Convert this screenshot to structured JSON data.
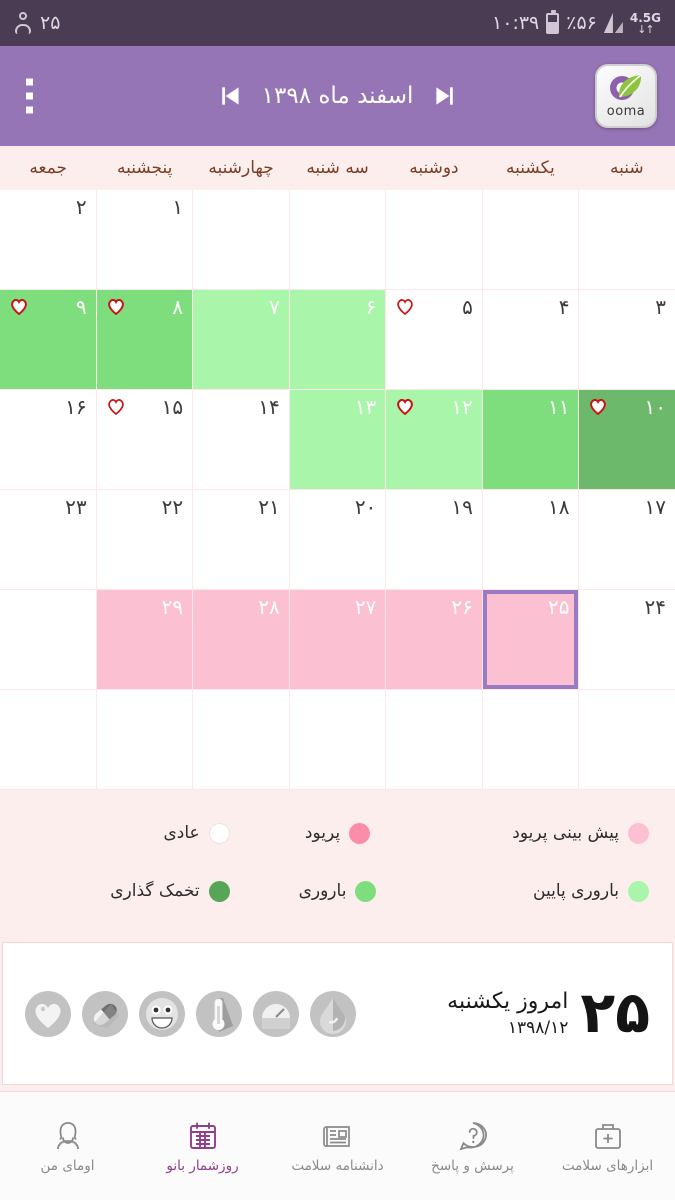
{
  "statusbar": {
    "time": "۱۰:۳۹",
    "battery_percent": "٪۵۶",
    "network": "4.5G",
    "network_arrows": "↓↑",
    "right_count": "۲۵",
    "icons": [
      "battery-icon",
      "signal-icon",
      "network-icon",
      "person-icon"
    ]
  },
  "toolbar": {
    "app_name": "ooma",
    "month_title": "اسفند ماه ۱۳۹۸",
    "prev_icon": "skip-previous-icon",
    "next_icon": "skip-next-icon",
    "overflow_icon": "overflow-menu-icon",
    "background": "#9575b5"
  },
  "weekdays": [
    "شنبه",
    "یکشنبه",
    "دوشنبه",
    "سه شنبه",
    "چهارشنبه",
    "پنجشنبه",
    "جمعه"
  ],
  "calendar": {
    "cells": [
      {
        "num": "",
        "status": "empty",
        "heart": "none",
        "today": false
      },
      {
        "num": "",
        "status": "empty",
        "heart": "none",
        "today": false
      },
      {
        "num": "",
        "status": "empty",
        "heart": "none",
        "today": false
      },
      {
        "num": "",
        "status": "empty",
        "heart": "none",
        "today": false
      },
      {
        "num": "",
        "status": "empty",
        "heart": "none",
        "today": false
      },
      {
        "num": "۱",
        "status": "normal",
        "heart": "none",
        "today": false
      },
      {
        "num": "۲",
        "status": "normal",
        "heart": "none",
        "today": false
      },
      {
        "num": "۳",
        "status": "normal",
        "heart": "none",
        "today": false
      },
      {
        "num": "۴",
        "status": "normal",
        "heart": "none",
        "today": false
      },
      {
        "num": "۵",
        "status": "normal",
        "heart": "outline",
        "today": false
      },
      {
        "num": "۶",
        "status": "fertile-low",
        "heart": "none",
        "today": false
      },
      {
        "num": "۷",
        "status": "fertile-low",
        "heart": "none",
        "today": false
      },
      {
        "num": "۸",
        "status": "fertile",
        "heart": "filled",
        "today": false
      },
      {
        "num": "۹",
        "status": "fertile",
        "heart": "filled",
        "today": false
      },
      {
        "num": "۱۰",
        "status": "ovulation",
        "heart": "filled",
        "today": false
      },
      {
        "num": "۱۱",
        "status": "fertile",
        "heart": "none",
        "today": false
      },
      {
        "num": "۱۲",
        "status": "fertile-low",
        "heart": "filled",
        "today": false
      },
      {
        "num": "۱۳",
        "status": "fertile-low",
        "heart": "none",
        "today": false
      },
      {
        "num": "۱۴",
        "status": "normal",
        "heart": "none",
        "today": false
      },
      {
        "num": "۱۵",
        "status": "normal",
        "heart": "outline",
        "today": false
      },
      {
        "num": "۱۶",
        "status": "normal",
        "heart": "none",
        "today": false
      },
      {
        "num": "۱۷",
        "status": "normal",
        "heart": "none",
        "today": false
      },
      {
        "num": "۱۸",
        "status": "normal",
        "heart": "none",
        "today": false
      },
      {
        "num": "۱۹",
        "status": "normal",
        "heart": "none",
        "today": false
      },
      {
        "num": "۲۰",
        "status": "normal",
        "heart": "none",
        "today": false
      },
      {
        "num": "۲۱",
        "status": "normal",
        "heart": "none",
        "today": false
      },
      {
        "num": "۲۲",
        "status": "normal",
        "heart": "none",
        "today": false
      },
      {
        "num": "۲۳",
        "status": "normal",
        "heart": "none",
        "today": false
      },
      {
        "num": "۲۴",
        "status": "normal",
        "heart": "none",
        "today": false
      },
      {
        "num": "۲۵",
        "status": "predict",
        "heart": "none",
        "today": true
      },
      {
        "num": "۲۶",
        "status": "predict",
        "heart": "none",
        "today": false
      },
      {
        "num": "۲۷",
        "status": "predict",
        "heart": "none",
        "today": false
      },
      {
        "num": "۲۸",
        "status": "predict",
        "heart": "none",
        "today": false
      },
      {
        "num": "۲۹",
        "status": "predict",
        "heart": "none",
        "today": false
      },
      {
        "num": "",
        "status": "empty",
        "heart": "none",
        "today": false
      },
      {
        "num": "",
        "status": "empty",
        "heart": "none",
        "today": false
      },
      {
        "num": "",
        "status": "empty",
        "heart": "none",
        "today": false
      },
      {
        "num": "",
        "status": "empty",
        "heart": "none",
        "today": false
      },
      {
        "num": "",
        "status": "empty",
        "heart": "none",
        "today": false
      },
      {
        "num": "",
        "status": "empty",
        "heart": "none",
        "today": false
      },
      {
        "num": "",
        "status": "empty",
        "heart": "none",
        "today": false
      },
      {
        "num": "",
        "status": "empty",
        "heart": "none",
        "today": false
      }
    ],
    "today_border_color": "#9a7ac0"
  },
  "legend": [
    {
      "label": "عادی",
      "color": "#ffffff"
    },
    {
      "label": "پریود",
      "color": "#fb8da8"
    },
    {
      "label": "پیش بینی پریود",
      "color": "#fbc0d2"
    },
    {
      "label": "تخمک گذاری",
      "color": "#57a657"
    },
    {
      "label": "باروری",
      "color": "#7ede7e"
    },
    {
      "label": "باروری پایین",
      "color": "#a9f5a9"
    }
  ],
  "today_card": {
    "day_number": "۲۵",
    "day_label": "امروز یکشنبه",
    "date": "۱۳۹۸/۱۲",
    "icons": [
      {
        "name": "water-drop-icon"
      },
      {
        "name": "weight-scale-icon"
      },
      {
        "name": "thermometer-icon"
      },
      {
        "name": "mood-smiley-icon"
      },
      {
        "name": "pill-icon"
      },
      {
        "name": "heart-icon"
      }
    ]
  },
  "bottomnav": {
    "active_color": "#8e3f8e",
    "items": [
      {
        "label": "ابزارهای سلامت",
        "icon": "medical-kit-icon",
        "active": false
      },
      {
        "label": "پرسش و پاسخ",
        "icon": "question-bubble-icon",
        "active": false
      },
      {
        "label": "دانشنامه سلامت",
        "icon": "newspaper-icon",
        "active": false
      },
      {
        "label": "روزشمار بانو",
        "icon": "calendar-icon",
        "active": true
      },
      {
        "label": "اومای من",
        "icon": "woman-icon",
        "active": false
      }
    ]
  }
}
